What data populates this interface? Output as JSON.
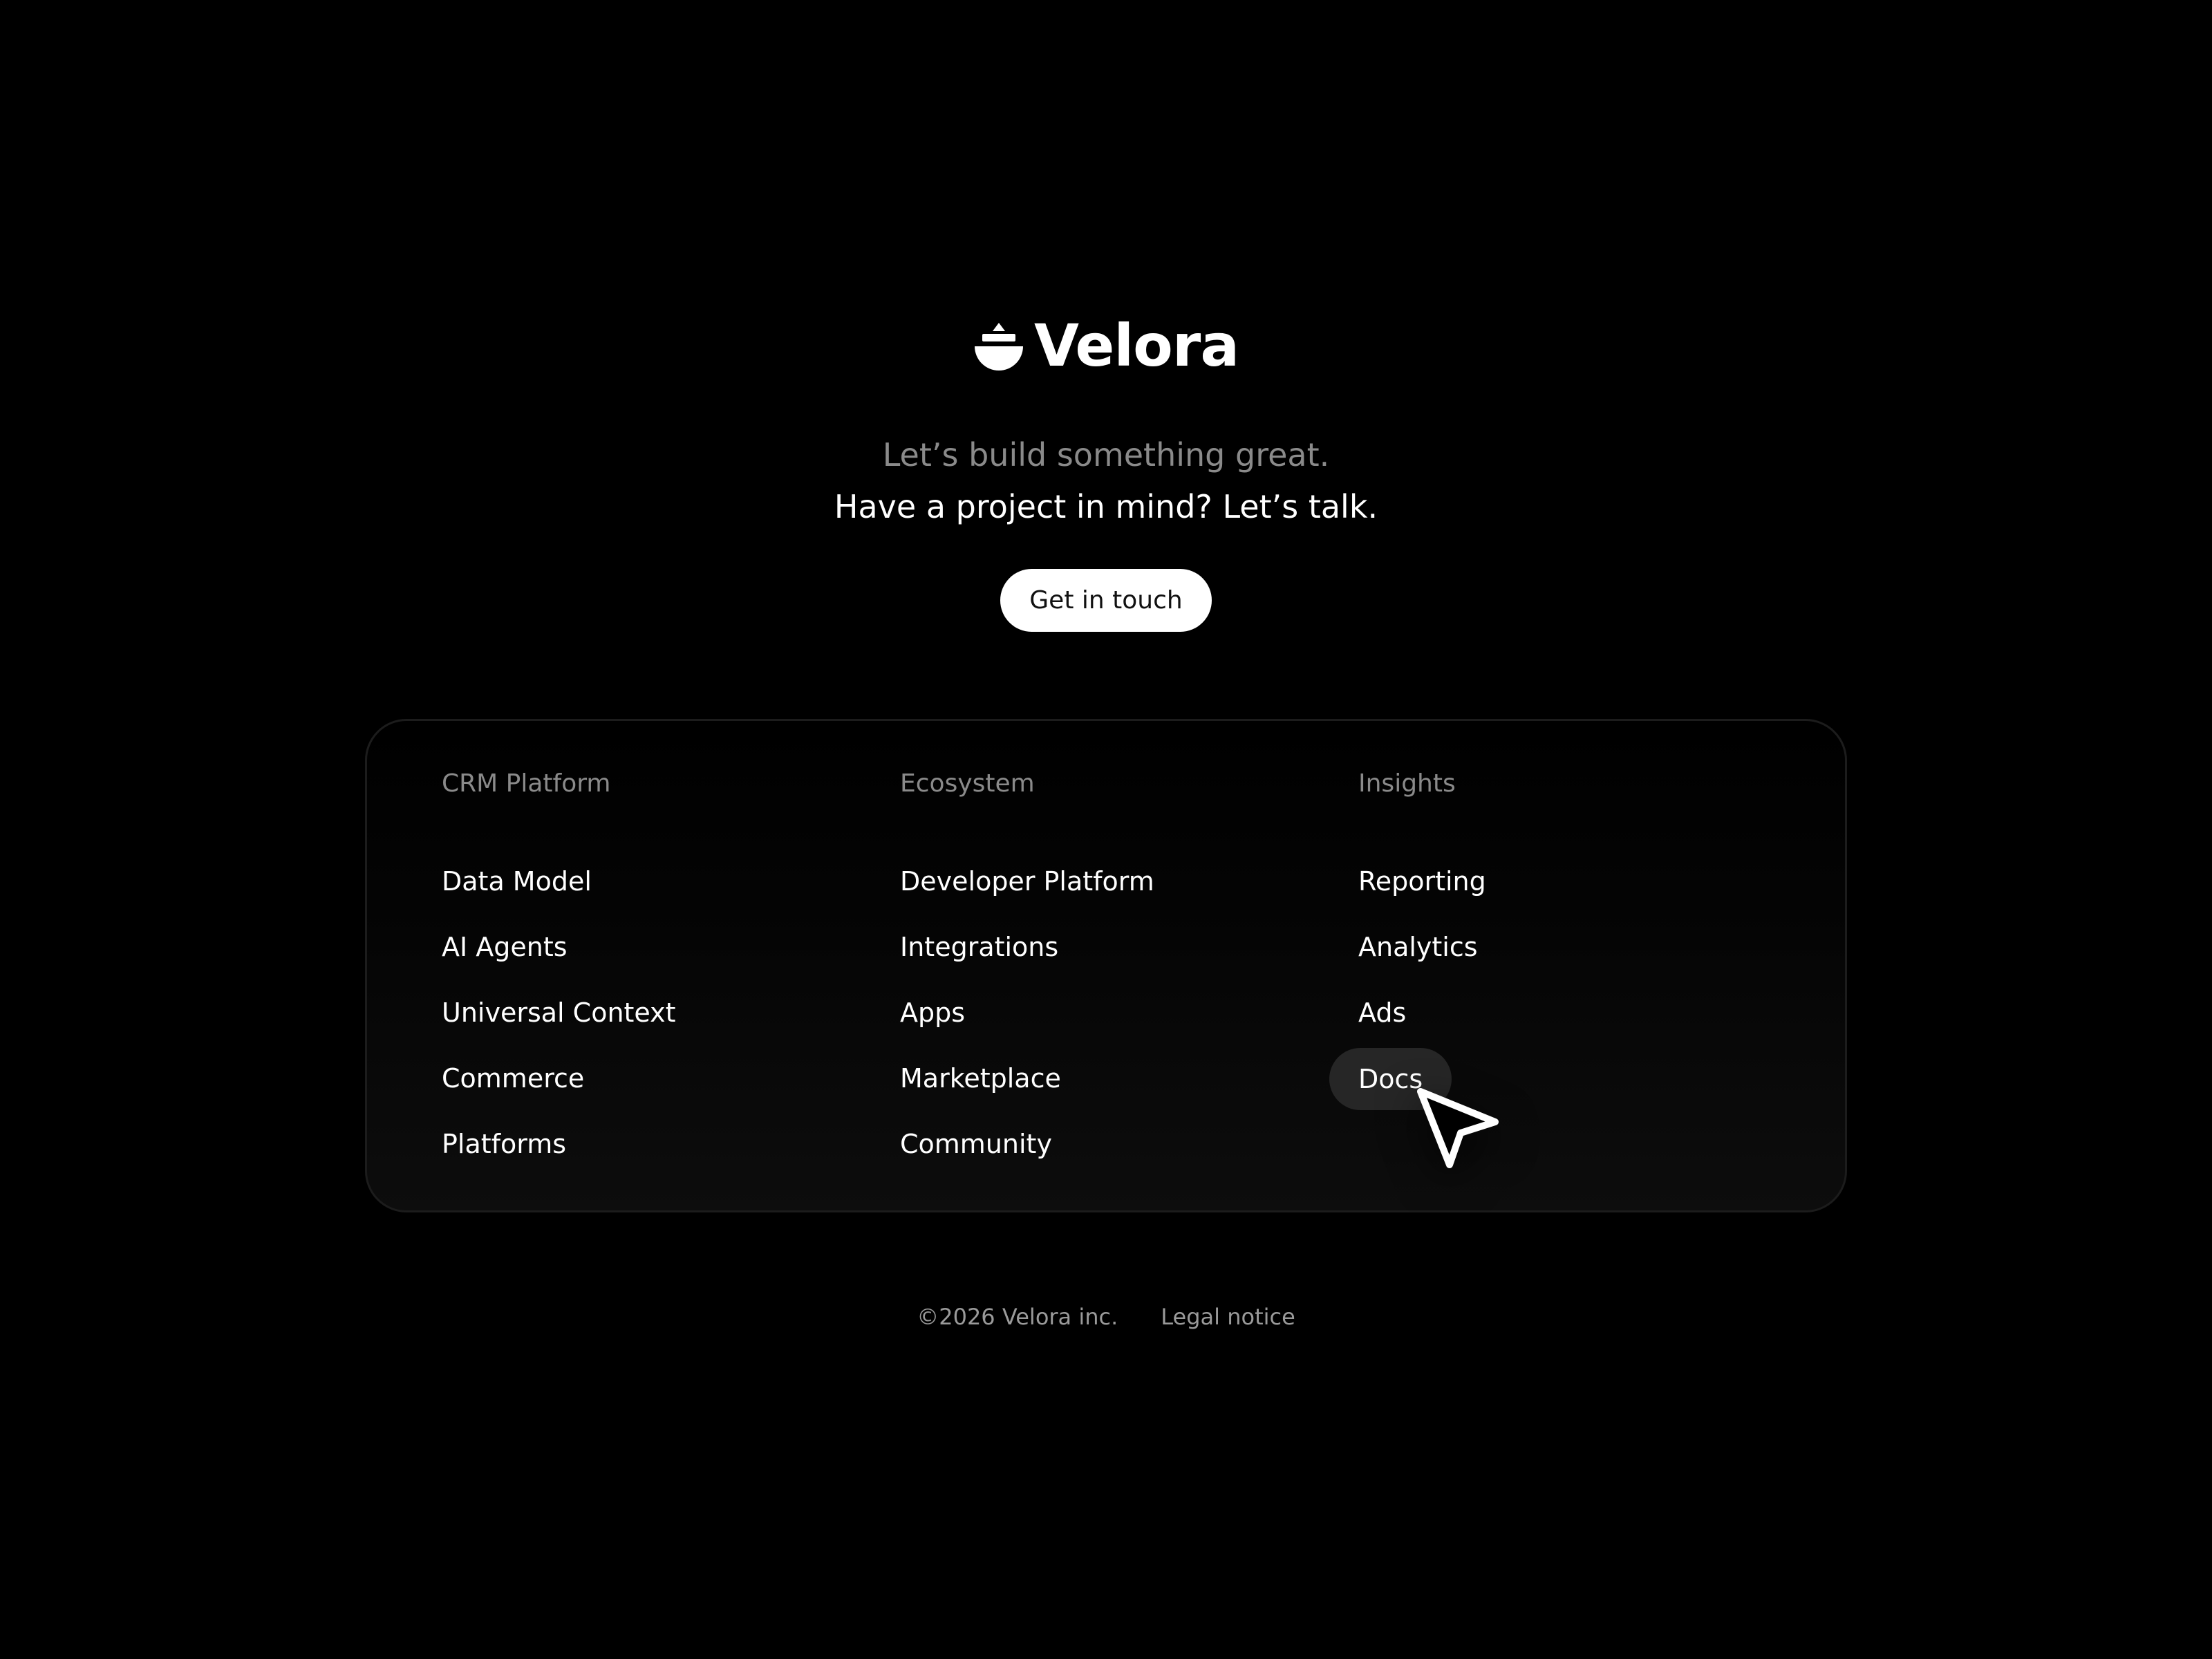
{
  "brand": {
    "name": "Velora",
    "logo_icon": "velora-logo-icon"
  },
  "hero": {
    "tagline": "Let’s build something great.",
    "headline": "Have a project in mind? Let’s talk.",
    "cta_label": "Get in touch"
  },
  "nav": {
    "columns": [
      {
        "heading": "CRM Platform",
        "links": [
          "Data Model",
          "AI Agents",
          "Universal Context",
          "Commerce",
          "Platforms"
        ]
      },
      {
        "heading": "Ecosystem",
        "links": [
          "Developer Platform",
          "Integrations",
          "Apps",
          "Marketplace",
          "Community"
        ]
      },
      {
        "heading": "Insights",
        "links": [
          "Reporting",
          "Analytics",
          "Ads",
          "Docs"
        ]
      }
    ],
    "hovered_link": "Docs"
  },
  "footer": {
    "copyright": "©2026 Velora inc.",
    "legal_label": "Legal notice"
  },
  "colors": {
    "background": "#000000",
    "text_primary": "#ffffff",
    "text_muted": "#8a8a8a",
    "hover_pill": "#262626",
    "cta_background": "#ffffff"
  }
}
